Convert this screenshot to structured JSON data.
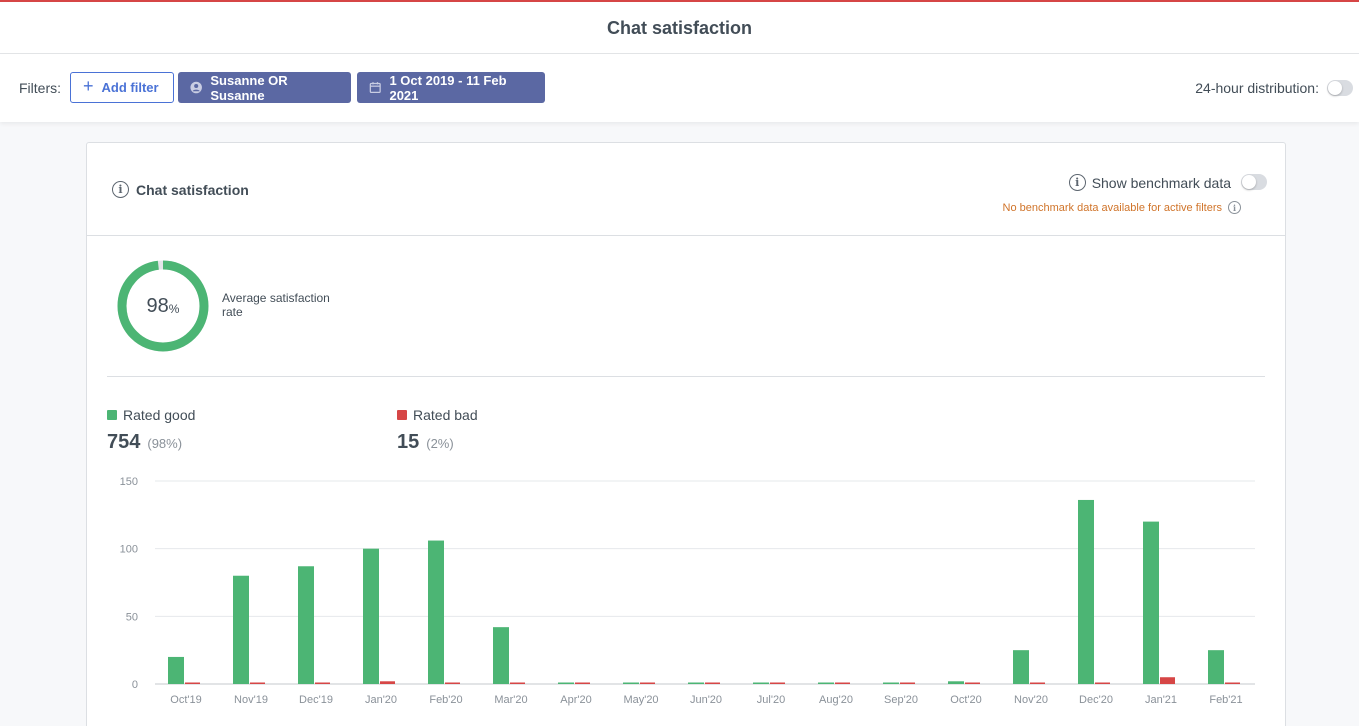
{
  "header": {
    "title": "Chat satisfaction"
  },
  "filters": {
    "label": "Filters:",
    "add_filter": "Add filter",
    "agent_filter": "Susanne OR Susanne",
    "date_filter": "1 Oct 2019 - 11 Feb 2021",
    "distribution_label": "24-hour distribution:",
    "distribution_on": false
  },
  "card": {
    "title": "Chat satisfaction",
    "benchmark_label": "Show benchmark data",
    "benchmark_on": false,
    "benchmark_note": "No benchmark data available for active filters"
  },
  "summary": {
    "rate_value": "98",
    "rate_unit": "%",
    "rate_fraction": 0.98,
    "rate_label": "Average satisfaction rate"
  },
  "legend": {
    "good_label": "Rated good",
    "good_count": "754",
    "good_pct": "(98%)",
    "bad_label": "Rated bad",
    "bad_count": "15",
    "bad_pct": "(2%)"
  },
  "colors": {
    "good": "#4cb574",
    "bad": "#d64646",
    "primary": "#4a72d6",
    "filter_chip": "#5b68a3",
    "warning": "#d0742a"
  },
  "chart_data": {
    "type": "bar",
    "categories": [
      "Oct'19",
      "Nov'19",
      "Dec'19",
      "Jan'20",
      "Feb'20",
      "Mar'20",
      "Apr'20",
      "May'20",
      "Jun'20",
      "Jul'20",
      "Aug'20",
      "Sep'20",
      "Oct'20",
      "Nov'20",
      "Dec'20",
      "Jan'21",
      "Feb'21"
    ],
    "series": [
      {
        "name": "Rated good",
        "values": [
          20,
          80,
          87,
          100,
          106,
          42,
          0,
          0,
          0,
          0,
          0,
          0,
          2,
          25,
          136,
          120,
          25
        ]
      },
      {
        "name": "Rated bad",
        "values": [
          0,
          0,
          0,
          2,
          0,
          1,
          0,
          0,
          0,
          0,
          0,
          0,
          0,
          0,
          0,
          5,
          0
        ]
      }
    ],
    "yticks": [
      0,
      50,
      100,
      150
    ],
    "ylim": [
      0,
      150
    ],
    "grid": true,
    "title": "",
    "xlabel": "",
    "ylabel": ""
  }
}
